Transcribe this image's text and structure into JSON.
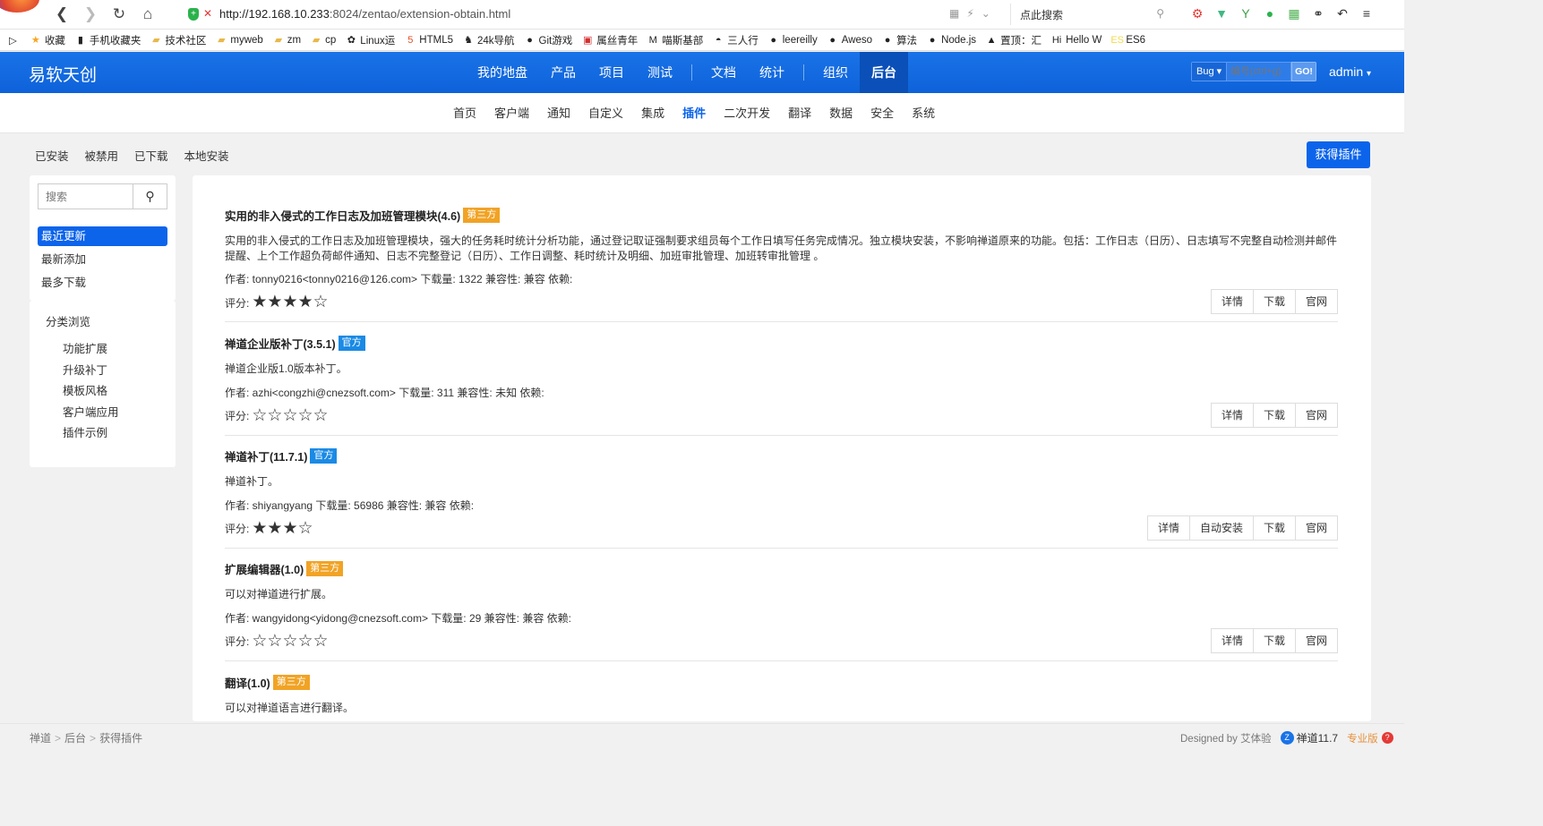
{
  "browser": {
    "url_host": "http://192.168.10.233",
    "url_rest": ":8024/zentao/extension-obtain.html",
    "search_placeholder": "点此搜索",
    "bookmarks": [
      {
        "label": "收藏",
        "icon": "star-icon"
      },
      {
        "label": "手机收藏夹",
        "icon": "phone-icon"
      },
      {
        "label": "技术社区",
        "icon": "folder-icon"
      },
      {
        "label": "myweb",
        "icon": "folder-icon"
      },
      {
        "label": "zm",
        "icon": "folder-icon"
      },
      {
        "label": "cp",
        "icon": "folder-icon"
      },
      {
        "label": "Linux运",
        "icon": "linux-icon"
      },
      {
        "label": "HTML5",
        "icon": "html5-icon"
      },
      {
        "label": "24k导航",
        "icon": "horse-icon"
      },
      {
        "label": "Git游戏",
        "icon": "github-icon"
      },
      {
        "label": "属丝青年",
        "icon": "news-icon"
      },
      {
        "label": "喵斯基部",
        "icon": "m-icon"
      },
      {
        "label": "三人行",
        "icon": "chat-icon"
      },
      {
        "label": "leereilly",
        "icon": "github-icon"
      },
      {
        "label": "Aweso",
        "icon": "github-icon"
      },
      {
        "label": "算法",
        "icon": "github-icon"
      },
      {
        "label": "Node.js",
        "icon": "github-icon"
      },
      {
        "label": "置顶：汇",
        "icon": "hat-icon"
      },
      {
        "label": "Hello W",
        "icon": "hi-icon"
      },
      {
        "label": "ES6",
        "icon": "es-icon"
      }
    ]
  },
  "header": {
    "brand": "易软天创",
    "nav": [
      "我的地盘",
      "产品",
      "项目",
      "测试",
      "文档",
      "统计",
      "组织",
      "后台"
    ],
    "active_nav": "后台",
    "search_type": "Bug",
    "search_placeholder": "编号(ctrl+g)",
    "search_go": "GO!",
    "user": "admin"
  },
  "subnav": [
    "首页",
    "客户端",
    "通知",
    "自定义",
    "集成",
    "插件",
    "二次开发",
    "翻译",
    "数据",
    "安全",
    "系统"
  ],
  "subnav_active": "插件",
  "toolbar": {
    "filters": [
      "已安装",
      "被禁用",
      "已下载",
      "本地安装"
    ],
    "primary_button": "获得插件"
  },
  "sidebar": {
    "search_placeholder": "搜索",
    "sort_items": [
      "最近更新",
      "最新添加",
      "最多下载"
    ],
    "active_sort": "最近更新",
    "category_title": "分类浏览",
    "categories": [
      "功能扩展",
      "升级补丁",
      "模板风格",
      "客户端应用",
      "插件示例"
    ]
  },
  "extensions": [
    {
      "title": "实用的非入侵式的工作日志及加班管理模块(4.6)",
      "badge": "第三方",
      "badge_type": "third",
      "desc": "实用的非入侵式的工作日志及加班管理模块，强大的任务耗时统计分析功能，通过登记取证强制要求组员每个工作日填写任务完成情况。独立模块安装，不影响禅道原来的功能。包括：工作日志（日历）、日志填写不完整自动检测并邮件提醒、上个工作超负荷邮件通知、日志不完整登记（日历）、工作日调整、耗时统计及明细、加班审批管理、加班转审批管理 。",
      "meta": "作者: tonny0216<tonny0216@126.com> 下载量: 1322 兼容性: 兼容 依赖:",
      "rating_label": "评分:",
      "rating": 4,
      "rating_max": 5,
      "buttons": [
        "详情",
        "下载",
        "官网"
      ]
    },
    {
      "title": "禅道企业版补丁(3.5.1)",
      "badge": "官方",
      "badge_type": "official",
      "desc": "禅道企业版1.0版本补丁。",
      "meta": "作者: azhi<congzhi@cnezsoft.com> 下载量: 311 兼容性: 未知 依赖:",
      "rating_label": "评分:",
      "rating": 0,
      "rating_max": 5,
      "buttons": [
        "详情",
        "下载",
        "官网"
      ]
    },
    {
      "title": "禅道补丁(11.7.1)",
      "badge": "官方",
      "badge_type": "official",
      "desc": "禅道补丁。",
      "meta": "作者: shiyangyang 下载量: 56986 兼容性: 兼容 依赖:",
      "rating_label": "评分:",
      "rating": 3,
      "rating_max": 4,
      "buttons": [
        "详情",
        "自动安装",
        "下载",
        "官网"
      ]
    },
    {
      "title": "扩展编辑器(1.0)",
      "badge": "第三方",
      "badge_type": "third",
      "desc": "可以对禅道进行扩展。",
      "meta": "作者: wangyidong<yidong@cnezsoft.com> 下载量: 29 兼容性: 兼容 依赖:",
      "rating_label": "评分:",
      "rating": 0,
      "rating_max": 5,
      "buttons": [
        "详情",
        "下载",
        "官网"
      ]
    },
    {
      "title": "翻译(1.0)",
      "badge": "第三方",
      "badge_type": "third",
      "desc": "可以对禅道语言进行翻译。",
      "meta": "",
      "rating_label": "",
      "rating": 0,
      "rating_max": 0,
      "buttons": []
    }
  ],
  "footer": {
    "breadcrumbs": [
      "禅道",
      "后台",
      "获得插件"
    ],
    "designed_by": "Designed by 艾体验",
    "version": "禅道11.7",
    "edition": "专业版"
  },
  "colors": {
    "primary": "#0c64eb",
    "header": "#1a73e8",
    "third_party_badge": "#f1a325",
    "official_badge": "#1a8ae5"
  }
}
